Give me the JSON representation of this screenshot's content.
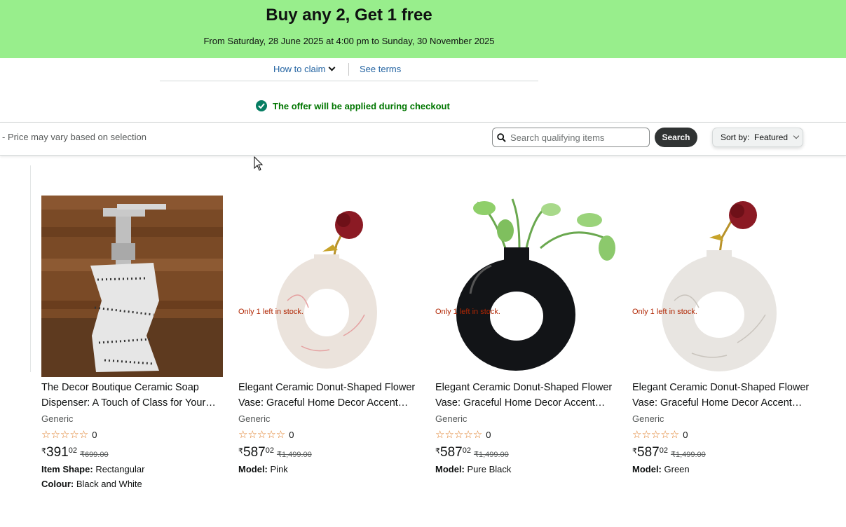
{
  "banner": {
    "title": "Buy any 2, Get 1 free",
    "subtitle": "From Saturday, 28 June 2025 at 4:00 pm to Sunday, 30 November 2025",
    "bg_color": "#98EE8C"
  },
  "claim": {
    "how_to_claim": "How to claim",
    "see_terms": "See terms"
  },
  "offer_note": "The offer will be applied during checkout",
  "toolbar": {
    "price_note": "- Price may vary based on selection",
    "search_placeholder": "Search qualifying items",
    "search_button": "Search",
    "sort_label": "Sort by:",
    "sort_value": "Featured"
  },
  "products": [
    {
      "title": "The Decor Boutique Ceramic Soap Dispenser: A Touch of Class for Your…",
      "brand": "Generic",
      "stars": "☆☆☆☆☆",
      "rating_count": "0",
      "currency": "₹",
      "price_whole": "391",
      "price_fraction": "02",
      "mrp": "₹699.00",
      "attrs": [
        {
          "label": "Item Shape:",
          "value": "Rectangular"
        },
        {
          "label": "Colour:",
          "value": "Black and White"
        }
      ],
      "stock": "",
      "image": "soap-dispenser"
    },
    {
      "title": "Elegant Ceramic Donut-Shaped Flower Vase: Graceful Home Decor Accent…",
      "brand": "Generic",
      "stars": "☆☆☆☆☆",
      "rating_count": "0",
      "currency": "₹",
      "price_whole": "587",
      "price_fraction": "02",
      "mrp": "₹1,499.00",
      "attrs": [
        {
          "label": "Model:",
          "value": "Pink"
        }
      ],
      "stock": "Only 1 left in stock.",
      "image": "donut-vase-pink-rose"
    },
    {
      "title": "Elegant Ceramic Donut-Shaped Flower Vase: Graceful Home Decor Accent…",
      "brand": "Generic",
      "stars": "☆☆☆☆☆",
      "rating_count": "0",
      "currency": "₹",
      "price_whole": "587",
      "price_fraction": "02",
      "mrp": "₹1,499.00",
      "attrs": [
        {
          "label": "Model:",
          "value": "Pure Black"
        }
      ],
      "stock": "Only 1 left in stock.",
      "image": "donut-vase-black-plant"
    },
    {
      "title": "Elegant Ceramic Donut-Shaped Flower Vase: Graceful Home Decor Accent…",
      "brand": "Generic",
      "stars": "☆☆☆☆☆",
      "rating_count": "0",
      "currency": "₹",
      "price_whole": "587",
      "price_fraction": "02",
      "mrp": "₹1,499.00",
      "attrs": [
        {
          "label": "Model:",
          "value": "Green"
        }
      ],
      "stock": "Only 1 left in stock.",
      "image": "donut-vase-white-rose"
    }
  ]
}
